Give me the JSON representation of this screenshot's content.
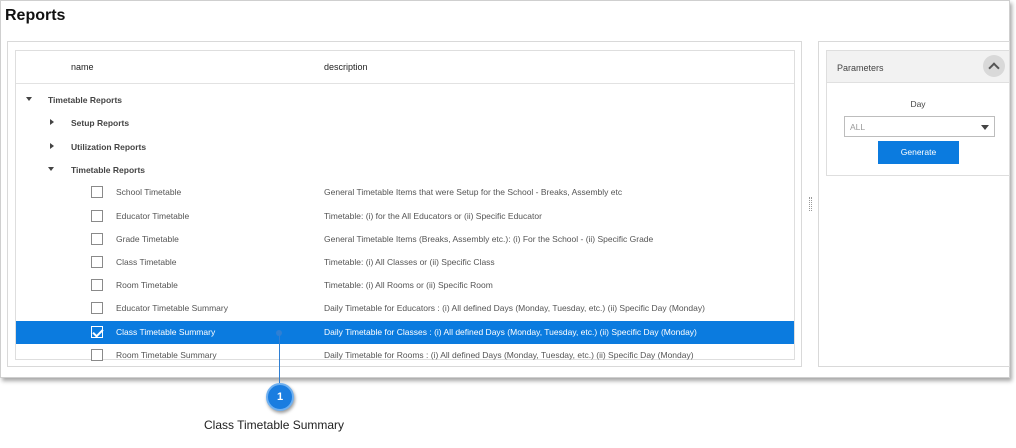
{
  "page": {
    "title": "Reports"
  },
  "grid": {
    "columns": {
      "name": "name",
      "description": "description"
    },
    "groups": {
      "root": "Timetable Reports",
      "setup": "Setup Reports",
      "utilization": "Utilization Reports",
      "timetable": "Timetable Reports"
    },
    "items": [
      {
        "name": "School Timetable",
        "description": "General Timetable Items that were Setup for the School - Breaks, Assembly etc",
        "checked": false
      },
      {
        "name": "Educator Timetable",
        "description": "Timetable: (i) for the All Educators or (ii) Specific Educator",
        "checked": false
      },
      {
        "name": "Grade Timetable",
        "description": "General Timetable Items (Breaks, Assembly etc.): (i) For the School - (ii) Specific Grade",
        "checked": false
      },
      {
        "name": "Class Timetable",
        "description": "Timetable: (i) All Classes or (ii) Specific Class",
        "checked": false
      },
      {
        "name": "Room Timetable",
        "description": "Timetable: (i) All Rooms or (ii) Specific Room",
        "checked": false
      },
      {
        "name": "Educator Timetable Summary",
        "description": "Daily Timetable for Educators : (i) All defined Days (Monday, Tuesday, etc.) (ii) Specific Day (Monday)",
        "checked": false
      },
      {
        "name": "Class Timetable Summary",
        "description": "Daily Timetable for Classes : (i) All defined Days (Monday, Tuesday, etc.) (ii) Specific Day (Monday)",
        "checked": true
      },
      {
        "name": "Room Timetable Summary",
        "description": "Daily Timetable for Rooms : (i) All defined Days (Monday, Tuesday, etc.) (ii) Specific Day (Monday)",
        "checked": false
      }
    ]
  },
  "parameters": {
    "title": "Parameters",
    "day_label": "Day",
    "day_value": "ALL",
    "generate_label": "Generate"
  },
  "callout": {
    "number": "1",
    "caption": "Class Timetable Summary"
  },
  "colors": {
    "selection": "#0b7bdf",
    "callout": "#1a7de0"
  },
  "icons": {
    "collapse": "chevron-up-icon",
    "expanded": "caret-down-icon",
    "collapsed": "caret-right-icon",
    "checkbox": "checkbox-icon",
    "dropdown": "chevron-down-icon",
    "splitter": "grip-icon"
  }
}
